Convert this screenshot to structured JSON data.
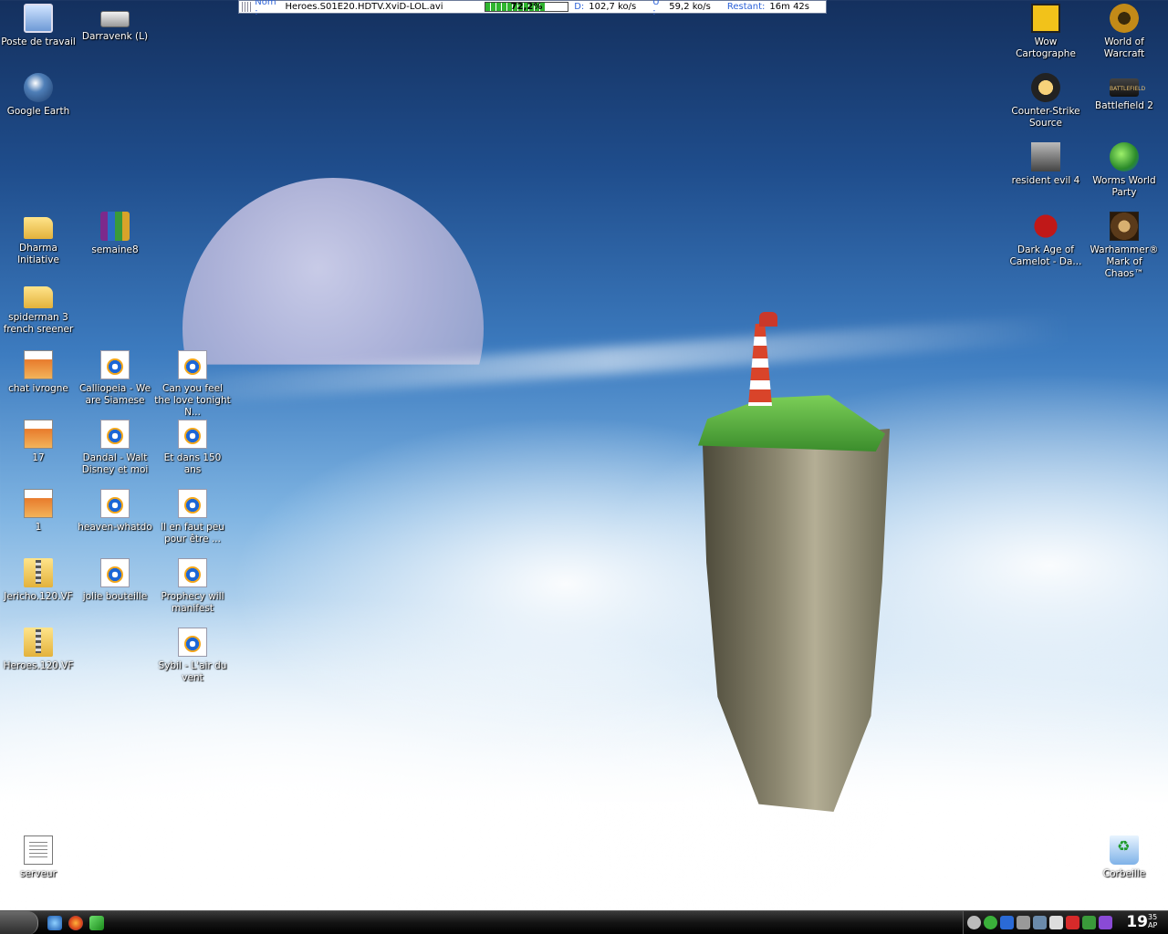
{
  "download_bar": {
    "name_label": "Nom :",
    "name_value": "Heroes.S01E20.HDTV.XviD-LOL.avi",
    "progress_percent": 72.2,
    "progress_text": "72,2%",
    "down_label": "D:",
    "down_value": "102,7 ko/s",
    "up_label": "U :",
    "up_value": "59,2 ko/s",
    "remaining_label": "Restant:",
    "remaining_value": "16m 42s"
  },
  "desktop_icons_left": [
    {
      "label": "Poste de travail",
      "icon": "computer-icon"
    },
    {
      "label": "Darravenk (L)",
      "icon": "drive-icon"
    },
    {
      "label": "Google Earth",
      "icon": "google-earth-icon"
    },
    {
      "label": "Dharma Initiative",
      "icon": "folder-icon"
    },
    {
      "label": "semaine8",
      "icon": "winrar-icon"
    },
    {
      "label": "spiderman 3 french sreener",
      "icon": "folder-icon"
    },
    {
      "label": "chat ivrogne",
      "icon": "image-icon"
    },
    {
      "label": "Calliopeia - We are Siamese",
      "icon": "media-player-icon"
    },
    {
      "label": "Can you feel the love tonight N...",
      "icon": "media-player-icon"
    },
    {
      "label": "17",
      "icon": "image-icon"
    },
    {
      "label": "Dandal - Walt Disney et moi",
      "icon": "media-player-icon"
    },
    {
      "label": "Et dans 150 ans",
      "icon": "media-player-icon"
    },
    {
      "label": "1",
      "icon": "image-icon"
    },
    {
      "label": "heaven-whatdo",
      "icon": "media-player-icon"
    },
    {
      "label": "Il en faut peu pour être ...",
      "icon": "media-player-icon"
    },
    {
      "label": "Jericho.120.VF",
      "icon": "zip-folder-icon"
    },
    {
      "label": "jolie bouteille",
      "icon": "media-player-icon"
    },
    {
      "label": "Prophecy will manifest",
      "icon": "media-player-icon"
    },
    {
      "label": "Heroes.120.VF",
      "icon": "zip-folder-icon"
    },
    {
      "label": "Sybil - L'air du vent",
      "icon": "media-player-icon"
    },
    {
      "label": "serveur",
      "icon": "text-file-icon"
    }
  ],
  "desktop_icons_right": [
    {
      "label": "Wow Cartographe",
      "icon": "wow-cartographe-icon"
    },
    {
      "label": "World of Warcraft",
      "icon": "wow-icon"
    },
    {
      "label": "Counter-Strike Source",
      "icon": "counter-strike-icon"
    },
    {
      "label": "Battlefield 2",
      "icon": "battlefield-icon"
    },
    {
      "label": "resident evil 4",
      "icon": "resident-evil-icon"
    },
    {
      "label": "Worms World Party",
      "icon": "worms-icon"
    },
    {
      "label": "Dark Age of Camelot - Da...",
      "icon": "daoc-icon"
    },
    {
      "label": "Warhammer® Mark of Chaos™",
      "icon": "warhammer-icon"
    },
    {
      "label": "Corbeille",
      "icon": "recycle-bin-icon"
    }
  ],
  "battlefield_logo_text": "BATTLEFIELD",
  "taskbar": {
    "clock_hour": "19",
    "clock_min": "35",
    "clock_ampm": "AP"
  }
}
